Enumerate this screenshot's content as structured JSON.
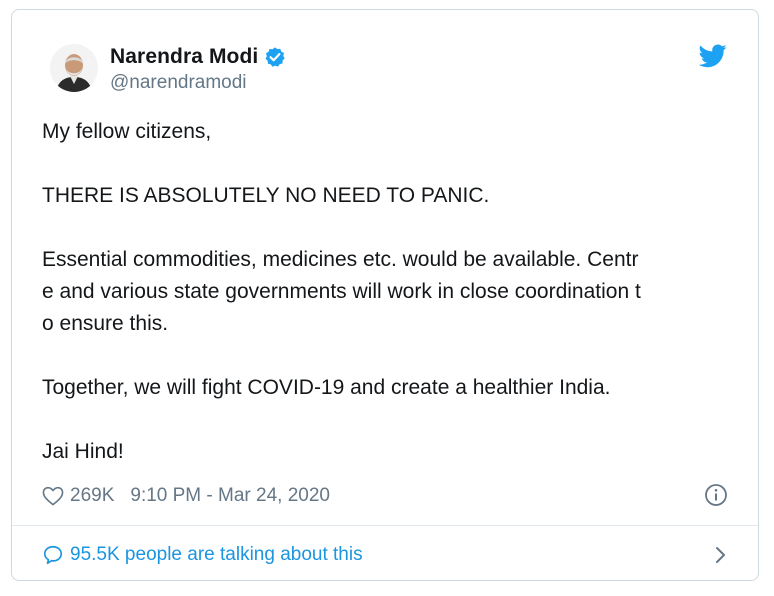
{
  "author": {
    "name": "Narendra Modi",
    "handle": "@narendramodi",
    "verified": true
  },
  "tweet": {
    "paragraphs": [
      "My fellow citizens,",
      "THERE IS ABSOLUTELY NO NEED TO PANIC.",
      "Essential commodities, medicines etc. would be available. Centr\ne and various state governments will work in close coordination t\no ensure this.",
      "Together, we will fight COVID-19 and create a healthier India.",
      "Jai Hind!"
    ]
  },
  "meta": {
    "likes": "269K",
    "timestamp": "9:10 PM - Mar 24, 2020"
  },
  "footer": {
    "conversation_text": "95.5K people are talking about this"
  },
  "icons": {
    "verified": "verified-badge-icon",
    "brand": "twitter-bird-icon",
    "like": "heart-icon",
    "info": "info-icon",
    "conversation": "speech-bubble-icon",
    "more": "chevron-right-icon"
  },
  "colors": {
    "brand_blue": "#1da1f2",
    "link_blue": "#1b95e0",
    "secondary_text": "#657786",
    "border": "#cfd9de"
  }
}
